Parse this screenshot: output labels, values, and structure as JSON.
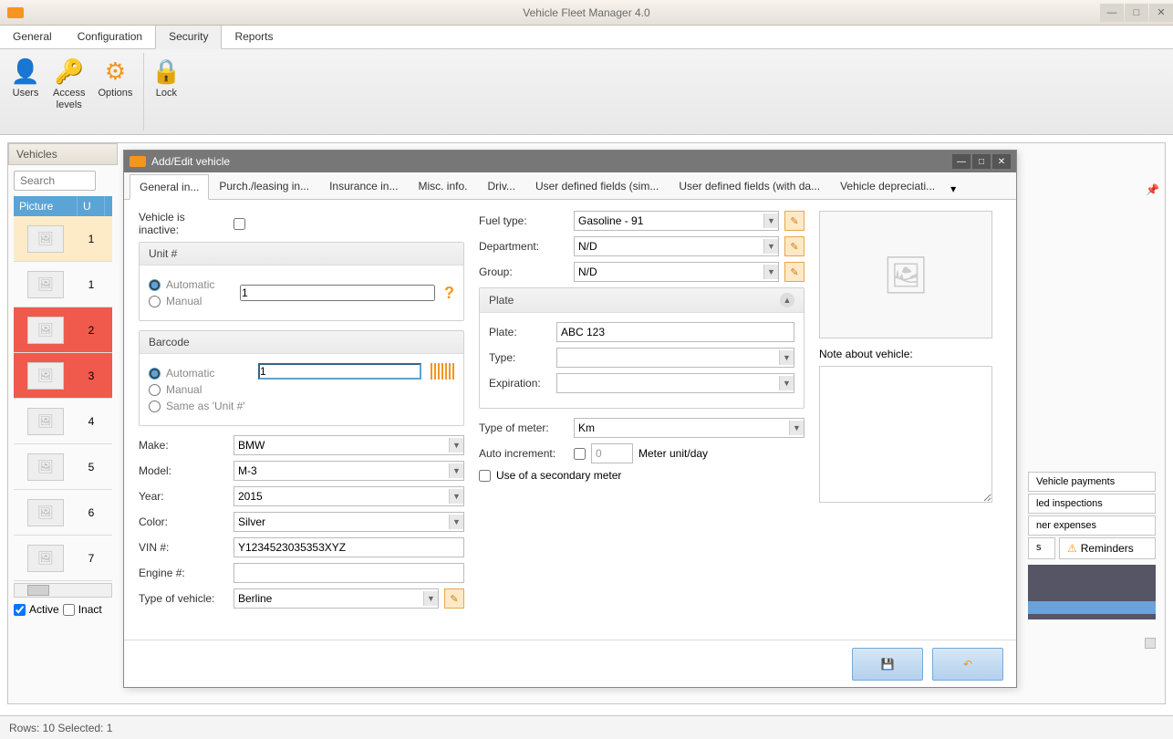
{
  "app": {
    "title": "Vehicle Fleet Manager 4.0"
  },
  "menu": {
    "general": "General",
    "configuration": "Configuration",
    "security": "Security",
    "reports": "Reports"
  },
  "ribbon": {
    "users": "Users",
    "access": "Access\nlevels",
    "options": "Options",
    "lock": "Lock"
  },
  "vehicles": {
    "header": "Vehicles",
    "search_placeholder": "Search",
    "col_picture": "Picture",
    "col_unit": "U",
    "rows": [
      {
        "unit": "1"
      },
      {
        "unit": "1"
      },
      {
        "unit": "2"
      },
      {
        "unit": "3"
      },
      {
        "unit": "4"
      },
      {
        "unit": "5"
      },
      {
        "unit": "6"
      },
      {
        "unit": "7"
      }
    ],
    "active": "Active",
    "inactive": "Inact"
  },
  "side": {
    "payments": "Vehicle payments",
    "inspections": "led inspections",
    "expenses": "ner expenses",
    "s_tab": "s",
    "reminders": "Reminders"
  },
  "dialog": {
    "title": "Add/Edit vehicle",
    "tabs": {
      "general": "General in...",
      "purch": "Purch./leasing in...",
      "insurance": "Insurance in...",
      "misc": "Misc. info.",
      "driv": "Driv...",
      "udf1": "User defined fields (sim...",
      "udf2": "User defined fields (with da...",
      "deprec": "Vehicle depreciati..."
    },
    "fields": {
      "inactive_label": "Vehicle is inactive:",
      "unit_group": "Unit #",
      "automatic": "Automatic",
      "manual": "Manual",
      "unit_value": "1",
      "barcode_group": "Barcode",
      "barcode_value": "1",
      "same_as_unit": "Same as 'Unit #'",
      "make_label": "Make:",
      "make_value": "BMW",
      "model_label": "Model:",
      "model_value": "M-3",
      "year_label": "Year:",
      "year_value": "2015",
      "color_label": "Color:",
      "color_value": "Silver",
      "vin_label": "VIN #:",
      "vin_value": "Y1234523035353XYZ",
      "engine_label": "Engine #:",
      "engine_value": "",
      "type_label": "Type of vehicle:",
      "type_value": "Berline",
      "fuel_label": "Fuel type:",
      "fuel_value": "Gasoline - 91",
      "dept_label": "Department:",
      "dept_value": "N/D",
      "group_label": "Group:",
      "group_value": "N/D",
      "plate_group": "Plate",
      "plate_label": "Plate:",
      "plate_value": "ABC 123",
      "platetype_label": "Type:",
      "platetype_value": "",
      "expiration_label": "Expiration:",
      "expiration_value": "",
      "meter_label": "Type of meter:",
      "meter_value": "Km",
      "autoinc_label": "Auto increment:",
      "meterunit_value": "0",
      "meterunit_label": "Meter unit/day",
      "secondary_label": "Use of a secondary meter",
      "note_label": "Note about vehicle:"
    }
  },
  "status": {
    "text": "Rows: 10  Selected: 1"
  }
}
